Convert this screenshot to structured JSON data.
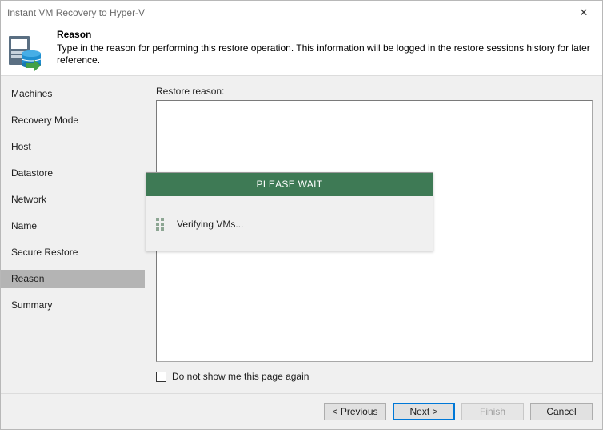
{
  "window": {
    "title": "Instant VM Recovery to Hyper-V",
    "close_glyph": "✕"
  },
  "header": {
    "title": "Reason",
    "description": "Type in the reason for performing this restore operation. This information will be logged in the restore sessions history for later reference.",
    "icon": "restore-database-icon"
  },
  "sidebar": {
    "steps": [
      {
        "label": "Machines"
      },
      {
        "label": "Recovery Mode"
      },
      {
        "label": "Host"
      },
      {
        "label": "Datastore"
      },
      {
        "label": "Network"
      },
      {
        "label": "Name"
      },
      {
        "label": "Secure Restore"
      },
      {
        "label": "Reason"
      },
      {
        "label": "Summary"
      }
    ],
    "active_step": "Reason"
  },
  "content": {
    "reason_label": "Restore reason:",
    "reason_value": "",
    "checkbox_label": "Do not show me this page again",
    "checkbox_checked": false
  },
  "footer": {
    "previous_label": "< Previous",
    "next_label": "Next >",
    "finish_label": "Finish",
    "cancel_label": "Cancel"
  },
  "wait_dialog": {
    "title": "PLEASE WAIT",
    "message": "Verifying VMs...",
    "header_color": "#3e7a55"
  }
}
